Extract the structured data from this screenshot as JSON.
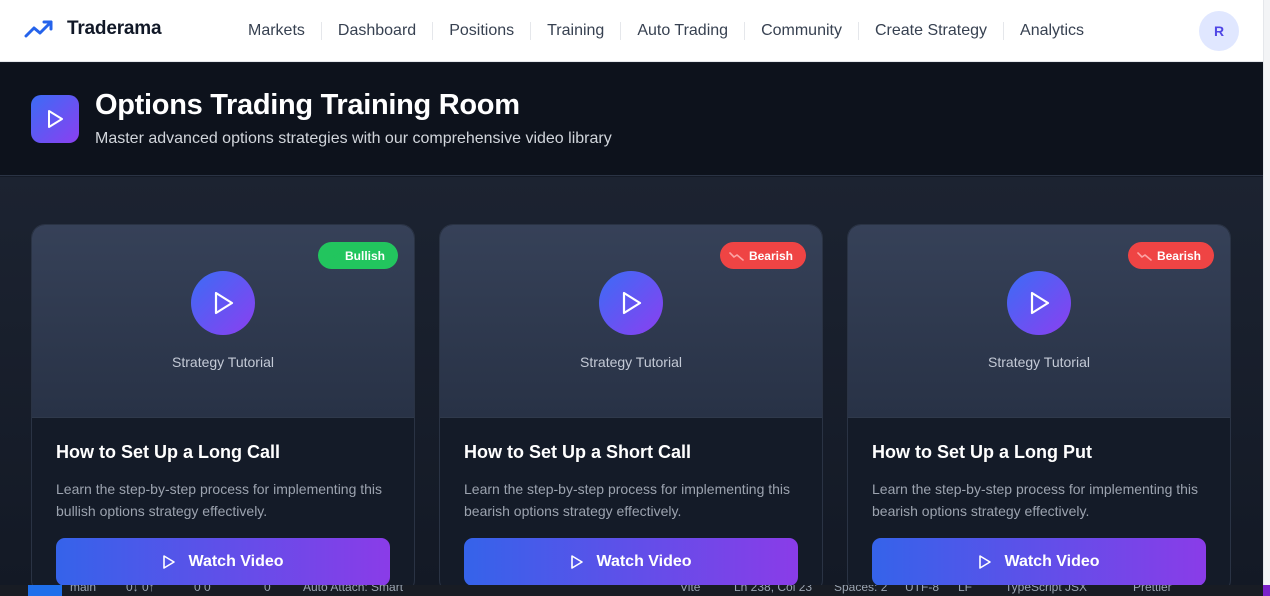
{
  "app": {
    "name": "Traderama",
    "avatar_initial": "R"
  },
  "nav": {
    "items": [
      "Markets",
      "Dashboard",
      "Positions",
      "Training",
      "Auto Trading",
      "Community",
      "Create Strategy",
      "Analytics"
    ]
  },
  "hero": {
    "title": "Options Trading Training Room",
    "subtitle": "Master advanced options strategies with our comprehensive video library"
  },
  "cards": [
    {
      "badge": "Bullish",
      "sentiment": "bullish",
      "media_label": "Strategy Tutorial",
      "title": "How to Set Up a Long Call",
      "description": "Learn the step-by-step process for implementing this bullish options strategy effectively.",
      "button": "Watch Video"
    },
    {
      "badge": "Bearish",
      "sentiment": "bearish",
      "media_label": "Strategy Tutorial",
      "title": "How to Set Up a Short Call",
      "description": "Learn the step-by-step process for implementing this bearish options strategy effectively.",
      "button": "Watch Video"
    },
    {
      "badge": "Bearish",
      "sentiment": "bearish",
      "media_label": "Strategy Tutorial",
      "title": "How to Set Up a Long Put",
      "description": "Learn the step-by-step process for implementing this bearish options strategy effectively.",
      "button": "Watch Video"
    }
  ],
  "statusbar": {
    "branch": "main",
    "sync": "0↓ 0↑",
    "problems": "0 0",
    "ports": "0",
    "auto_attach": "Auto Attach: Smart",
    "vite": "Vite",
    "cursor": "Ln 238, Col 23",
    "spaces": "Spaces: 2",
    "encoding": "UTF-8",
    "eol": "LF",
    "language": "TypeScript JSX",
    "prettier": "Prettier"
  },
  "colors": {
    "accent_start": "#3b6cf6",
    "accent_end": "#8b3ff0",
    "bullish": "#22c55e",
    "bearish": "#ef4444"
  },
  "icons": {
    "logo": "trending-up-icon",
    "hero": "play-icon",
    "bullish_badge": "trending-up-icon",
    "bearish_badge": "trending-down-icon",
    "video": "play-circle-icon"
  }
}
